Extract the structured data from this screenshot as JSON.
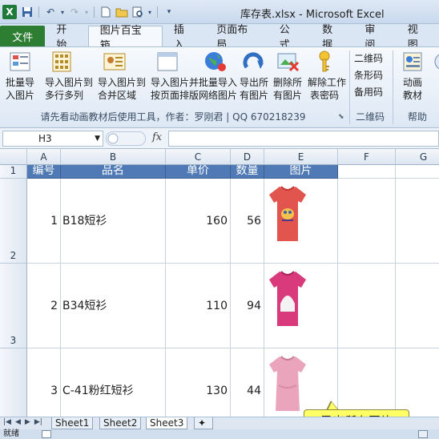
{
  "window": {
    "title": "库存表.xlsx - Microsoft Excel"
  },
  "ribbon_tabs": [
    "文件",
    "开始",
    "图片百宝箱",
    "插入",
    "页面布局",
    "公式",
    "数据",
    "审阅",
    "视图"
  ],
  "ribbon": {
    "buttons": [
      {
        "line1": "批量导",
        "line2": "入图片"
      },
      {
        "line1": "导入图片到",
        "line2": "多行多列"
      },
      {
        "line1": "导入图片到",
        "line2": "合并区域"
      },
      {
        "line1": "导入图片并",
        "line2": "按页面排版"
      },
      {
        "line1": "批量导入",
        "line2": "网络图片"
      },
      {
        "line1": "导出所",
        "line2": "有图片"
      },
      {
        "line1": "删除所",
        "line2": "有图片"
      },
      {
        "line1": "解除工作",
        "line2": "表密码"
      }
    ],
    "group1_caption": "请先看动画教材后使用工具，作者：罗刚君 | QQ 670218239",
    "code_items": [
      "二维码",
      "条形码",
      "备用码"
    ],
    "group2_caption": "二维码",
    "help_button": {
      "line1": "动画",
      "line2": "教材"
    },
    "group3_caption": "帮助"
  },
  "formula_bar": {
    "name_box": "H3",
    "fx": "fx",
    "value": ""
  },
  "columns": [
    "A",
    "B",
    "C",
    "D",
    "E",
    "F",
    "G"
  ],
  "rows": [
    "1",
    "2",
    "3"
  ],
  "table": {
    "headers": [
      "编号",
      "品名",
      "单价",
      "数量",
      "图片"
    ],
    "rows": [
      {
        "id": "1",
        "name": "B18短衫",
        "price": "160",
        "qty": "56"
      },
      {
        "id": "2",
        "name": "B34短衫",
        "price": "110",
        "qty": "94"
      },
      {
        "id": "3",
        "name": "C-41粉红短衫",
        "price": "130",
        "qty": "44"
      }
    ]
  },
  "tooltip": "导出所有图片",
  "sheets": [
    "Sheet1",
    "Sheet2",
    "Sheet3"
  ],
  "active_sheet": "Sheet3",
  "status": "就绪"
}
